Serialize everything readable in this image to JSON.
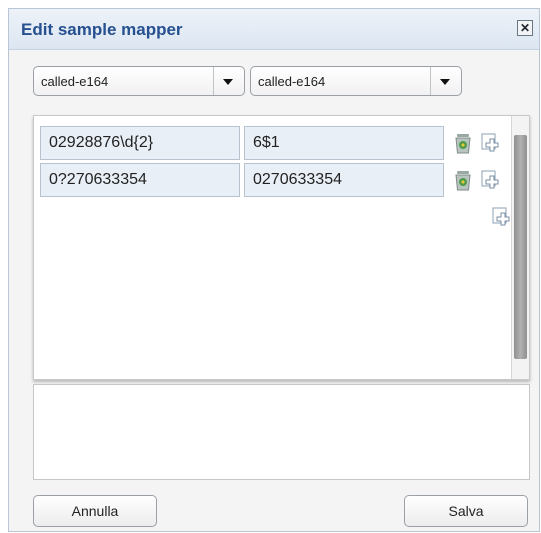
{
  "dialog": {
    "title": "Edit sample mapper",
    "close_glyph": "✕"
  },
  "selects": [
    {
      "value": "called-e164"
    },
    {
      "value": "called-e164"
    }
  ],
  "rows": [
    {
      "pattern": "02928876\\d{2}",
      "replacement": "6$1"
    },
    {
      "pattern": "0?270633354",
      "replacement": "0270633354"
    }
  ],
  "buttons": {
    "cancel": "Annulla",
    "save": "Salva"
  },
  "icons": {
    "trash": "trash-icon",
    "add": "add-icon",
    "close": "close-icon",
    "dropdown": "chevron-down-icon"
  }
}
